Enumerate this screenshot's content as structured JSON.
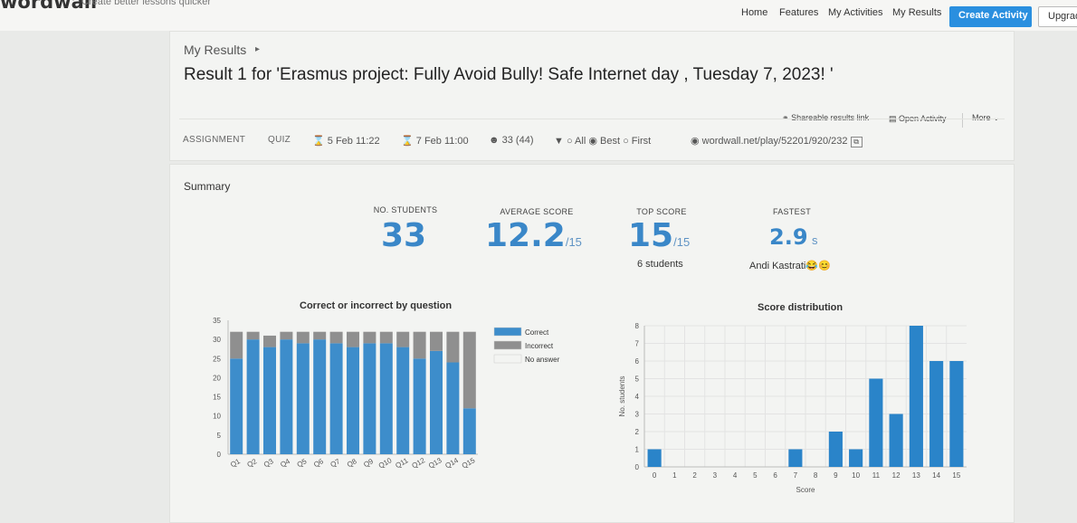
{
  "topbar": {
    "logo": "wordwall",
    "tagline": "Create better lessons quicker",
    "nav": [
      "Home",
      "Features",
      "My Activities",
      "My Results"
    ],
    "create_button": "Create Activity",
    "upgrade_button": "Upgrade"
  },
  "header": {
    "breadcrumb": "My Results",
    "title": "Result 1 for 'Erasmus project: Fully Avoid Bully! Safe Internet day , Tuesday 7, 2023! '",
    "actions": {
      "share": "Shareable results link",
      "open": "Open Activity",
      "more": "More"
    },
    "meta": {
      "assignment": "ASSIGNMENT",
      "quiz": "QUIZ",
      "start": "5 Feb 11:22",
      "end": "7 Feb 11:00",
      "participants": "33 (44)",
      "filter_all": "All",
      "filter_best": "Best",
      "filter_first": "First",
      "link": "wordwall.net/play/52201/920/232"
    }
  },
  "summary": {
    "title": "Summary",
    "students_label": "NO. STUDENTS",
    "students_value": "33",
    "avg_label": "AVERAGE SCORE",
    "avg_value": "12.2",
    "avg_max": "/15",
    "top_label": "TOP SCORE",
    "top_value": "15",
    "top_max": "/15",
    "top_sub": "6 students",
    "fast_label": "FASTEST",
    "fast_value": "2.9",
    "fast_unit": "s",
    "fast_sub": "Andi Kastrati😂😊"
  },
  "chart_data": [
    {
      "type": "bar",
      "title": "Correct or incorrect by question",
      "categories": [
        "Q1",
        "Q2",
        "Q3",
        "Q4",
        "Q5",
        "Q6",
        "Q7",
        "Q8",
        "Q9",
        "Q10",
        "Q11",
        "Q12",
        "Q13",
        "Q14",
        "Q15"
      ],
      "series": [
        {
          "name": "Correct",
          "color": "#3d8dcb",
          "values": [
            25,
            30,
            28,
            30,
            29,
            30,
            29,
            28,
            29,
            29,
            28,
            25,
            27,
            24,
            12
          ]
        },
        {
          "name": "Incorrect",
          "color": "#8f8f8f",
          "values": [
            7,
            2,
            3,
            2,
            3,
            2,
            3,
            4,
            3,
            3,
            4,
            7,
            5,
            8,
            20
          ]
        },
        {
          "name": "No answer",
          "color": "#f3f4f2",
          "values": [
            0,
            0,
            0,
            0,
            0,
            0,
            0,
            0,
            0,
            0,
            0,
            0,
            0,
            0,
            0
          ]
        }
      ],
      "stacked": true,
      "ylim": [
        0,
        35
      ],
      "yticks": [
        0,
        5,
        10,
        15,
        20,
        25,
        30,
        35
      ],
      "legend": "right"
    },
    {
      "type": "bar",
      "title": "Score distribution",
      "xlabel": "Score",
      "ylabel": "No. students",
      "categories": [
        "0",
        "1",
        "2",
        "3",
        "4",
        "5",
        "6",
        "7",
        "8",
        "9",
        "10",
        "11",
        "12",
        "13",
        "14",
        "15"
      ],
      "values": [
        1,
        0,
        0,
        0,
        0,
        0,
        0,
        1,
        0,
        2,
        1,
        5,
        3,
        8,
        6,
        6
      ],
      "color": "#2a84c9",
      "ylim": [
        0,
        8
      ],
      "yticks": [
        0,
        1,
        2,
        3,
        4,
        5,
        6,
        7,
        8
      ],
      "grid": true
    }
  ]
}
